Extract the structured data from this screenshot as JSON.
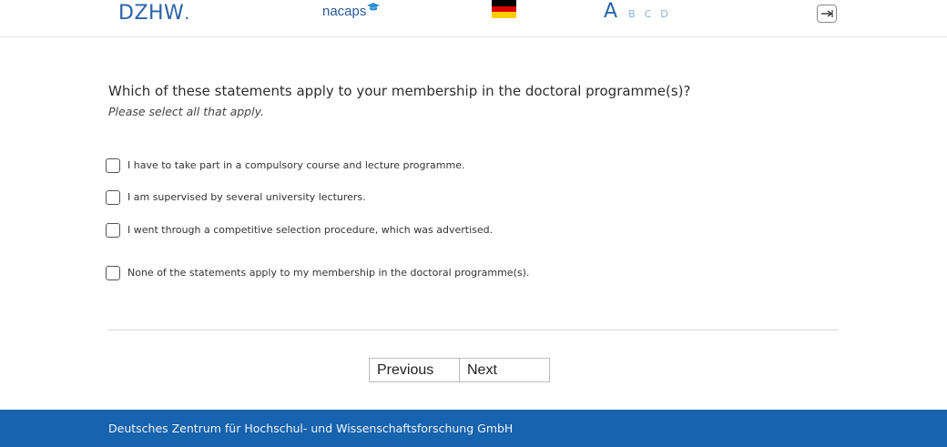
{
  "header": {
    "logo_left": "DZHW",
    "logo_left_suffix": ".",
    "logo_center": "nacaps",
    "language_flag": "germany-flag",
    "font_size_options": [
      "A",
      "B",
      "C",
      "D"
    ],
    "exit_icon": "exit-arrow-icon"
  },
  "question": {
    "text": "Which of these statements apply to your membership in the doctoral programme(s)?",
    "instruction": "Please select all that apply.",
    "options": [
      {
        "label": "I have to take part in a compulsory course and lecture programme.",
        "checked": false
      },
      {
        "label": "I am supervised by several university lecturers.",
        "checked": false
      },
      {
        "label": "I went through a competitive selection procedure, which was advertised.",
        "checked": false
      },
      {
        "label": "None of the statements apply to my membership in the doctoral programme(s).",
        "checked": false
      }
    ]
  },
  "navigation": {
    "previous_label": "Previous",
    "next_label": "Next"
  },
  "footer": {
    "text": "Deutsches Zentrum für Hochschul- und Wissenschaftsforschung GmbH"
  },
  "colors": {
    "brand_blue": "#2a62a8",
    "footer_blue": "#1763ad",
    "font_size_inactive": "#8db0d8"
  }
}
